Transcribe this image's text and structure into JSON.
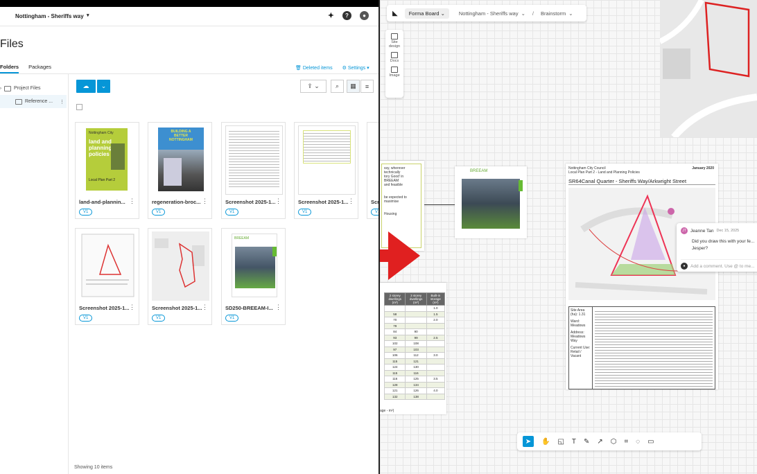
{
  "left": {
    "project_name": "Nottingham - Sheriffs way",
    "page_title": "Files",
    "tabs": [
      "Folders",
      "Packages"
    ],
    "deleted_items": "Deleted items",
    "settings": "Settings",
    "tree": [
      "Project Files",
      "Reference ..."
    ],
    "cards": [
      {
        "name": "land-and-plannin...",
        "version": "V1"
      },
      {
        "name": "regeneration-broc...",
        "version": "V1"
      },
      {
        "name": "Screenshot 2025-1...",
        "version": "V1"
      },
      {
        "name": "Screenshot 2025-1...",
        "version": "V1"
      },
      {
        "name": "Scr",
        "version": "V1"
      },
      {
        "name": "Screenshot 2025-1...",
        "version": "V1"
      },
      {
        "name": "Screenshot 2025-1...",
        "version": "V1"
      },
      {
        "name": "SD250-BREEAM-I...",
        "version": "V1"
      }
    ],
    "thumb_text": {
      "land_top": "Nottingham City",
      "land_title": "land and planning policies",
      "land_sub": "Local Plan Part 2",
      "regen_title": "BUILDING A BETTER NOTTINGHAM",
      "breeam": "BREEAM"
    },
    "footer": "Showing 10 items"
  },
  "right": {
    "app": "Forma Board",
    "breadcrumb_project": "Nottingham - Sheriffs way",
    "breadcrumb_sep": "/",
    "breadcrumb_board": "Brainstorm",
    "side_items": [
      "Site design",
      "Docs",
      "Image"
    ],
    "doc": {
      "council": "Nottingham City Council",
      "plan": "Local Plan Part 2 - Land and Planning Policies",
      "date": "January 2020",
      "site": "SR64Canal Quarter - Sheriffs Way/Arkwright Street",
      "labels": [
        "Site Area (ha): 1.31",
        "Ward: Meadows",
        "Address: Meadows Way",
        "Current Use: Retail / Vacant"
      ]
    },
    "table": {
      "headers": [
        "2 storey dwellings (m²)",
        "3 storey dwellings (m²)",
        "Built-in storage (m²)"
      ],
      "rows": [
        [
          "",
          "",
          "1.0"
        ],
        [
          "58",
          "",
          "1.5"
        ],
        [
          "70",
          "",
          "2.0"
        ],
        [
          "79",
          "",
          ""
        ],
        [
          "84",
          "90",
          ""
        ],
        [
          "93",
          "99",
          "2.5"
        ],
        [
          "102",
          "108",
          ""
        ],
        [
          "97",
          "103",
          ""
        ],
        [
          "106",
          "112",
          "3.0"
        ],
        [
          "115",
          "121",
          ""
        ],
        [
          "124",
          "130",
          ""
        ],
        [
          "115",
          "116",
          ""
        ],
        [
          "116",
          "125",
          "3.5"
        ],
        [
          "128",
          "134",
          ""
        ],
        [
          "121",
          "126",
          "4.0"
        ],
        [
          "132",
          "138",
          ""
        ]
      ],
      "footnote": "age - m²)"
    },
    "note_fragment": [
      "ssy, wherever technically",
      "tory Good' in BREEAM",
      "and feasible",
      "be expected to maximise",
      "Housing"
    ],
    "breeam_label": "BREEAM",
    "comment": {
      "author": "Jeanne Tan",
      "date": "Dec 15, 2025",
      "text": "Did you draw this with your fe... Jesper?",
      "placeholder": "Add a comment. Use @ to me..."
    },
    "tools": [
      "select",
      "hand",
      "note",
      "T",
      "draw",
      "arrow",
      "shape",
      "frame",
      "comment",
      "present"
    ]
  }
}
